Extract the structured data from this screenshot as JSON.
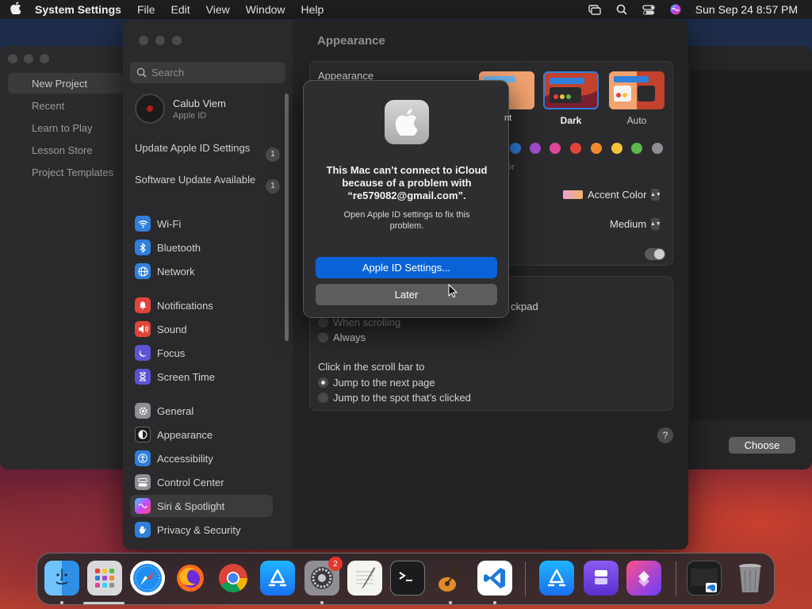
{
  "menubar": {
    "app_name": "System Settings",
    "menus": [
      "File",
      "Edit",
      "View",
      "Window",
      "Help"
    ],
    "clock": "Sun Sep 24  8:57 PM"
  },
  "background_window": {
    "items": [
      "New Project",
      "Recent",
      "Learn to Play",
      "Lesson Store",
      "Project Templates"
    ],
    "choose_label": "Choose"
  },
  "settings": {
    "search_placeholder": "Search",
    "profile": {
      "name": "Calub Viem",
      "subtitle": "Apple ID"
    },
    "notices": [
      {
        "label": "Update Apple ID Settings",
        "badge": "1"
      },
      {
        "label": "Software Update Available",
        "badge": "1"
      }
    ],
    "sidebar_groups": [
      [
        {
          "label": "Wi-Fi",
          "icon": "wifi-icon",
          "color": "#2f7fdc"
        },
        {
          "label": "Bluetooth",
          "icon": "bluetooth-icon",
          "color": "#2f7fdc"
        },
        {
          "label": "Network",
          "icon": "globe-icon",
          "color": "#2f7fdc"
        }
      ],
      [
        {
          "label": "Notifications",
          "icon": "bell-icon",
          "color": "#e0453a"
        },
        {
          "label": "Sound",
          "icon": "speaker-icon",
          "color": "#e0453a"
        },
        {
          "label": "Focus",
          "icon": "moon-icon",
          "color": "#5b55d6"
        },
        {
          "label": "Screen Time",
          "icon": "hourglass-icon",
          "color": "#5b55d6"
        }
      ],
      [
        {
          "label": "General",
          "icon": "gear-icon",
          "color": "#8e8e93"
        },
        {
          "label": "Appearance",
          "icon": "appearance-icon",
          "color": "#1c1c1e"
        },
        {
          "label": "Accessibility",
          "icon": "accessibility-icon",
          "color": "#2f7fdc"
        },
        {
          "label": "Control Center",
          "icon": "control-center-icon",
          "color": "#8e8e93"
        },
        {
          "label": "Siri & Spotlight",
          "icon": "siri-icon",
          "color": "#b04bd6"
        },
        {
          "label": "Privacy & Security",
          "icon": "hand-icon",
          "color": "#2f7fdc"
        }
      ]
    ],
    "selected_item": "Siri & Spotlight",
    "main": {
      "title": "Appearance",
      "appearance_label": "Appearance",
      "themes": [
        "Light",
        "Dark",
        "Auto"
      ],
      "selected_theme": "Dark",
      "accent_colors": [
        "#2f7fdc",
        "#a24bd0",
        "#e0479b",
        "#e5423a",
        "#f0892c",
        "#f5c33b",
        "#5ab948",
        "#8e8e93"
      ],
      "accent_popup": "Accent Color",
      "accent_sub_label": "or",
      "sidebar_icon_size": "Medium",
      "trackpad_text": "ckpad",
      "show_scrollbars_options": [
        "When scrolling",
        "Always"
      ],
      "click_scrollbar_label": "Click in the scroll bar to",
      "click_options": [
        "Jump to the next page",
        "Jump to the spot that’s clicked"
      ],
      "click_selected": 0,
      "help_label": "?"
    }
  },
  "alert": {
    "title": "This Mac can’t connect to iCloud because of a problem with “re579082@gmail.com”.",
    "message": "Open Apple ID settings to fix this problem.",
    "primary_button": "Apple ID Settings...",
    "secondary_button": "Later",
    "visible_label_fragment": "nt"
  },
  "dock": {
    "apps": [
      {
        "name": "Finder",
        "icon": "finder-icon",
        "running": true
      },
      {
        "name": "Launchpad",
        "icon": "launchpad-icon",
        "running": false
      },
      {
        "name": "Safari",
        "icon": "safari-icon",
        "running": false
      },
      {
        "name": "Firefox",
        "icon": "firefox-icon",
        "running": false
      },
      {
        "name": "Chrome",
        "icon": "chrome-icon",
        "running": false
      },
      {
        "name": "App Store",
        "icon": "app-store-icon",
        "running": false
      },
      {
        "name": "System Settings",
        "icon": "settings-icon",
        "running": true,
        "badge": "2"
      },
      {
        "name": "TextEdit",
        "icon": "textedit-icon",
        "running": false
      },
      {
        "name": "Terminal",
        "icon": "terminal-icon",
        "running": false
      },
      {
        "name": "GarageBand",
        "icon": "garageband-icon",
        "running": true
      },
      {
        "name": "VS Code",
        "icon": "vscode-icon",
        "running": true
      },
      {
        "name": "App Store",
        "icon": "app-store-icon",
        "running": false
      },
      {
        "name": "Simulator",
        "icon": "simulator-icon",
        "running": false
      },
      {
        "name": "Shortcuts",
        "icon": "shortcuts-icon",
        "running": false
      },
      {
        "name": "VS Code Window",
        "icon": "window-preview-icon",
        "running": false
      },
      {
        "name": "Trash",
        "icon": "trash-icon",
        "running": false
      }
    ]
  }
}
